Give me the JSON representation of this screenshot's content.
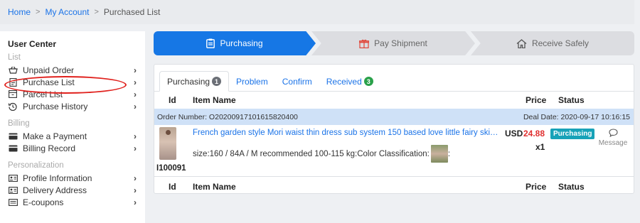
{
  "breadcrumb": {
    "home": "Home",
    "my_account": "My Account",
    "current": "Purchased List"
  },
  "sidebar": {
    "title": "User Center",
    "sections": {
      "list": "List",
      "billing": "Billing",
      "personalization": "Personalization"
    },
    "items": {
      "unpaid_order": "Unpaid Order",
      "purchase_list": "Purchase List",
      "parcel_list": "Parcel List",
      "purchase_history": "Purchase History",
      "make_payment": "Make a Payment",
      "billing_record": "Billing Record",
      "profile_info": "Profile Information",
      "delivery_address": "Delivery Address",
      "e_coupons": "E-coupons"
    },
    "chevron": "›"
  },
  "steps": {
    "purchasing": "Purchasing",
    "pay_shipment": "Pay Shipment",
    "receive_safely": "Receive Safely"
  },
  "tabs": {
    "purchasing": {
      "label": "Purchasing",
      "count": "1"
    },
    "problem": {
      "label": "Problem"
    },
    "confirm": {
      "label": "Confirm"
    },
    "received": {
      "label": "Received",
      "count": "3"
    }
  },
  "table": {
    "headers": {
      "id": "Id",
      "item_name": "Item Name",
      "price": "Price",
      "status": "Status"
    }
  },
  "order": {
    "number_label": "Order Number: O20200917101615820400",
    "deal_date": "Deal Date: 2020-09-17 10:16:15",
    "item": {
      "id": "I100091",
      "title": "French garden style Mori waist thin dress sub system 150 based love little fairy skirt women",
      "spec": "size:160 / 84A / M recommended 100-115 kg:Color Classification:",
      "spec_suffix": ":",
      "currency": "USD",
      "price": "24.88",
      "qty": "x1",
      "status": "Purchasing",
      "message": "Message"
    }
  },
  "colors": {
    "accent": "#1677e5",
    "link": "#1a73e8",
    "price": "#e02f2f",
    "status": "#17a2b8",
    "order_bar": "#cfe1f7",
    "highlight_oval": "#e0201c"
  },
  "icons": {
    "unpaid_order": "basket-icon",
    "purchase_list": "document-icon",
    "parcel_list": "box-icon",
    "purchase_history": "history-icon",
    "make_payment": "card-icon",
    "billing_record": "card-icon",
    "profile_info": "id-card-icon",
    "delivery_address": "address-card-icon",
    "e_coupons": "coupon-icon",
    "purchasing": "clipboard-icon",
    "pay_shipment": "gift-icon",
    "receive_safely": "home-icon",
    "message": "chat-bubble-icon"
  }
}
